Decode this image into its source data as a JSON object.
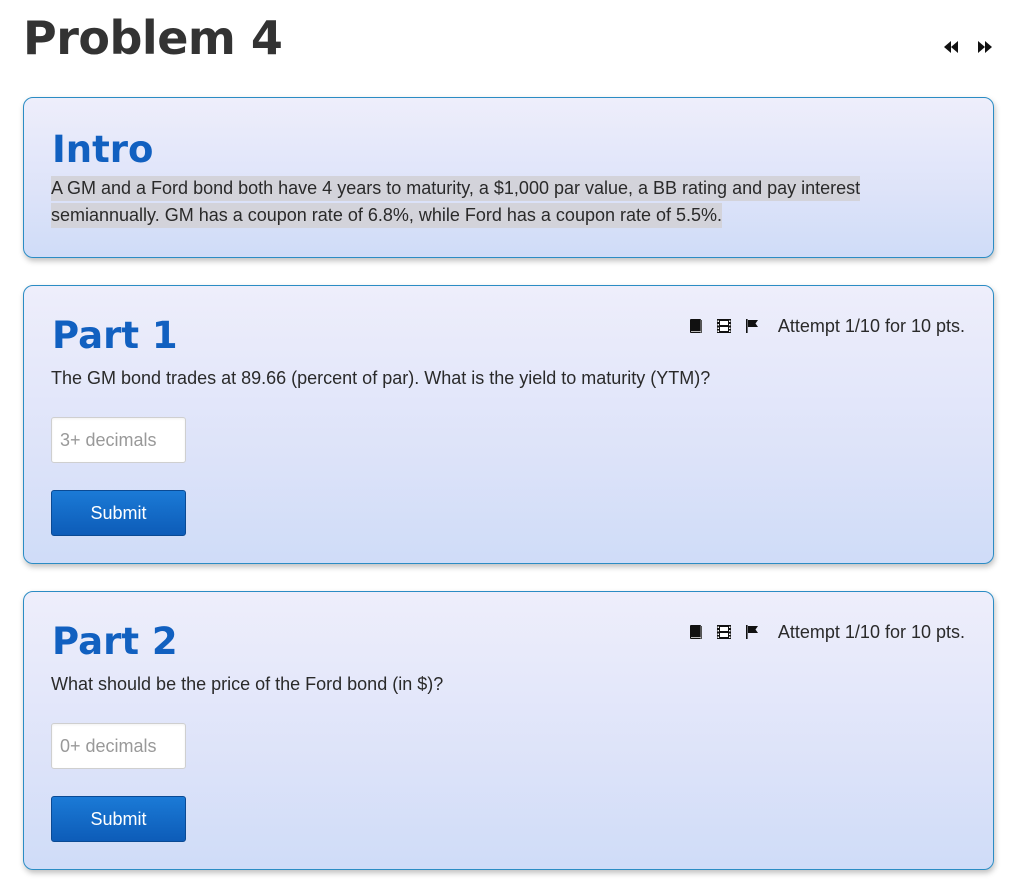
{
  "page": {
    "title": "Problem 4",
    "nav": {
      "prev_icon": "rewind-icon",
      "next_icon": "fast-forward-icon"
    }
  },
  "intro": {
    "heading": "Intro",
    "text": "A GM and a Ford bond both have 4 years to maturity, a $1,000 par value, a BB rating and pay interest semiannually. GM has a coupon rate of 6.8%, while Ford has a coupon rate of 5.5%."
  },
  "parts": [
    {
      "heading": "Part 1",
      "attempt": "Attempt 1/10 for 10 pts.",
      "question": "The GM bond trades at 89.66 (percent of par). What is the yield to maturity (YTM)?",
      "input_placeholder": "3+ decimals",
      "input_value": "",
      "submit_label": "Submit",
      "icons": [
        "book-icon",
        "film-icon",
        "flag-icon"
      ]
    },
    {
      "heading": "Part 2",
      "attempt": "Attempt 1/10 for 10 pts.",
      "question": "What should be the price of the Ford bond (in $)?",
      "input_placeholder": "0+ decimals",
      "input_value": "",
      "submit_label": "Submit",
      "icons": [
        "book-icon",
        "film-icon",
        "flag-icon"
      ]
    }
  ],
  "colors": {
    "heading_blue": "#1160c0",
    "card_border": "#2b8cc4",
    "button_blue": "#0d5cb8",
    "highlight_gray": "#d3d3da"
  }
}
